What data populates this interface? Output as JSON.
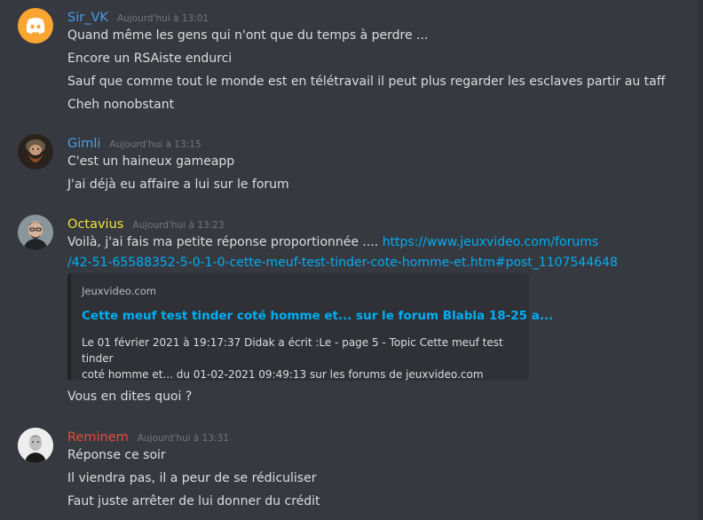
{
  "messages": [
    {
      "username": "Sir_VK",
      "username_color": "#4a9ee8",
      "timestamp": "Aujourd'hui à 13:01",
      "avatar": "discord-logo",
      "lines": [
        "Quand même les gens qui n'ont que du temps à perdre ...",
        "Encore un RSAiste endurci",
        "Sauf que comme tout le monde est en télétravail il peut plus regarder les esclaves partir au taff",
        "Cheh nonobstant"
      ]
    },
    {
      "username": "Gimli",
      "username_color": "#4a9ee8",
      "timestamp": "Aujourd'hui à 13:15",
      "avatar": "bearded-dwarf",
      "lines": [
        "C'est un haineux gameapp",
        "J'ai déjà eu affaire a lui sur le forum"
      ]
    },
    {
      "username": "Octavius",
      "username_color": "#f1e23a",
      "timestamp": "Aujourd'hui à 13:23",
      "avatar": "man-photo",
      "text_prefix": "Voilà, j'ai fais ma petite réponse proportionnée .... ",
      "link_part1": "https://www.jeuxvideo.com/forums",
      "link_part2": "/42-51-65588352-5-0-1-0-cette-meuf-test-tinder-cote-homme-et.htm#post_1107544648",
      "embed": {
        "provider": "Jeuxvideo.com",
        "title": "Cette meuf test tinder coté homme et... sur le forum Blabla 18-25 a...",
        "description_line1": "Le 01 février 2021 à 19:17:37 Didak a écrit :Le - page 5 - Topic Cette meuf test tinder",
        "description_line2": "coté homme et... du 01-02-2021 09:49:13 sur les forums de jeuxvideo.com"
      },
      "after_line": "Vous en dites quoi ?"
    },
    {
      "username": "Reminem",
      "username_color": "#e74c3c",
      "timestamp": "Aujourd'hui à 13:31",
      "avatar": "bw-man-photo",
      "lines": [
        "Réponse ce soir",
        "Il viendra pas, il a peur de se rédiculiser",
        "Faut juste arrêter de lui donner du crédit"
      ]
    }
  ]
}
